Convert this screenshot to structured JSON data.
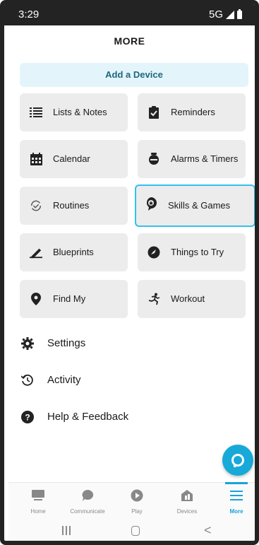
{
  "status": {
    "time": "3:29",
    "network": "5G"
  },
  "header": {
    "title": "MORE"
  },
  "add_device": {
    "label": "Add a Device"
  },
  "grid": [
    {
      "label": "Lists & Notes",
      "icon": "list-icon"
    },
    {
      "label": "Reminders",
      "icon": "clipboard-check-icon"
    },
    {
      "label": "Calendar",
      "icon": "calendar-icon"
    },
    {
      "label": "Alarms & Timers",
      "icon": "alarm-clock-icon"
    },
    {
      "label": "Routines",
      "icon": "routines-icon"
    },
    {
      "label": "Skills & Games",
      "icon": "skills-icon",
      "selected": true
    },
    {
      "label": "Blueprints",
      "icon": "pencil-icon"
    },
    {
      "label": "Things to Try",
      "icon": "compass-icon"
    },
    {
      "label": "Find My",
      "icon": "location-pin-icon"
    },
    {
      "label": "Workout",
      "icon": "running-person-icon"
    }
  ],
  "list": [
    {
      "label": "Settings",
      "icon": "gear-icon"
    },
    {
      "label": "Activity",
      "icon": "history-icon"
    },
    {
      "label": "Help & Feedback",
      "icon": "help-icon"
    }
  ],
  "tabbar": [
    {
      "label": "Home",
      "icon": "home-icon"
    },
    {
      "label": "Communicate",
      "icon": "chat-bubble-icon"
    },
    {
      "label": "Play",
      "icon": "play-icon"
    },
    {
      "label": "Devices",
      "icon": "devices-icon"
    },
    {
      "label": "More",
      "icon": "menu-icon",
      "active": true
    }
  ],
  "colors": {
    "accent": "#18a3d6",
    "selected_border": "#35c1ea",
    "card_bg": "#ececec",
    "banner_bg": "#e3f5fb"
  }
}
